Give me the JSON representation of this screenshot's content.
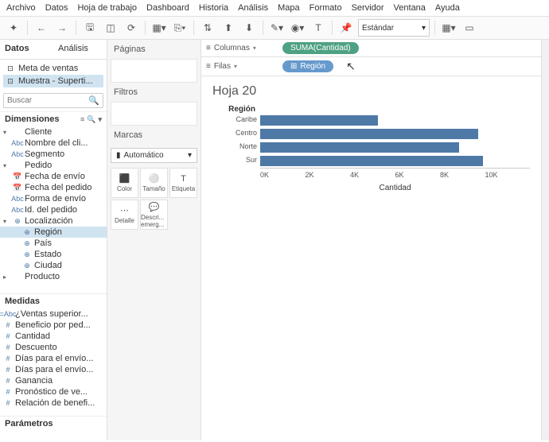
{
  "menu": [
    "Archivo",
    "Datos",
    "Hoja de trabajo",
    "Dashboard",
    "Historia",
    "Análisis",
    "Mapa",
    "Formato",
    "Servidor",
    "Ventana",
    "Ayuda"
  ],
  "toolbar_mode": "Estándar",
  "left": {
    "tabs": [
      "Datos",
      "Análisis"
    ],
    "sources": [
      {
        "label": "Meta de ventas",
        "active": false
      },
      {
        "label": "Muestra - Superti...",
        "active": true
      }
    ],
    "search_placeholder": "Buscar",
    "dimensions_label": "Dimensiones",
    "measures_label": "Medidas",
    "params_label": "Parámetros",
    "dim_tree": [
      {
        "lvl": 0,
        "exp": "▾",
        "ico": "",
        "label": "Cliente"
      },
      {
        "lvl": 1,
        "ico": "Abc",
        "label": "Nombre del cli..."
      },
      {
        "lvl": 1,
        "ico": "Abc",
        "label": "Segmento"
      },
      {
        "lvl": 0,
        "exp": "▾",
        "ico": "",
        "label": "Pedido"
      },
      {
        "lvl": 1,
        "ico": "date",
        "label": "Fecha de envío"
      },
      {
        "lvl": 1,
        "ico": "date",
        "label": "Fecha del pedido"
      },
      {
        "lvl": 1,
        "ico": "Abc",
        "label": "Forma de envío"
      },
      {
        "lvl": 1,
        "ico": "Abc",
        "label": "Id. del pedido"
      },
      {
        "lvl": 0,
        "exp": "▾",
        "ico": "geo",
        "label": "Localización"
      },
      {
        "lvl": 1,
        "ico": "geo",
        "label": "Región",
        "sel": true,
        "exp": ""
      },
      {
        "lvl": 1,
        "ico": "geo",
        "label": "País",
        "exp": ""
      },
      {
        "lvl": 1,
        "ico": "geo",
        "label": "Estado",
        "exp": ""
      },
      {
        "lvl": 1,
        "ico": "geo",
        "label": "Ciudad",
        "exp": ""
      },
      {
        "lvl": 0,
        "exp": "▸",
        "ico": "",
        "label": "Producto"
      }
    ],
    "measure_tree": [
      {
        "ico": "=Abc",
        "label": "¿Ventas superior..."
      },
      {
        "ico": "#",
        "label": "Beneficio por ped..."
      },
      {
        "ico": "#",
        "label": "Cantidad"
      },
      {
        "ico": "#",
        "label": "Descuento"
      },
      {
        "ico": "#",
        "label": "Días para el envío..."
      },
      {
        "ico": "#",
        "label": "Días para el envío..."
      },
      {
        "ico": "#",
        "label": "Ganancia"
      },
      {
        "ico": "#",
        "label": "Pronóstico de ve..."
      },
      {
        "ico": "#",
        "label": "Relación de benefi..."
      }
    ]
  },
  "mid": {
    "pages": "Páginas",
    "filters": "Filtros",
    "marks": "Marcas",
    "mark_type": "Automático",
    "cells": [
      "Color",
      "Tamaño",
      "Etiqueta",
      "Detalle",
      "Descri... emerg..."
    ]
  },
  "shelves": {
    "columns_label": "Columnas",
    "rows_label": "Filas",
    "columns_pill": "SUMA(Cantidad)",
    "rows_pill": "Región"
  },
  "chart_data": {
    "type": "bar",
    "title": "Hoja 20",
    "y_title": "Región",
    "xlabel": "Cantidad",
    "categories": [
      "Caribe",
      "Centro",
      "Norte",
      "Sur"
    ],
    "values": [
      4800,
      8900,
      8100,
      9100
    ],
    "xticks": [
      "0K",
      "2K",
      "4K",
      "6K",
      "8K",
      "10K"
    ],
    "xmax": 11000
  }
}
